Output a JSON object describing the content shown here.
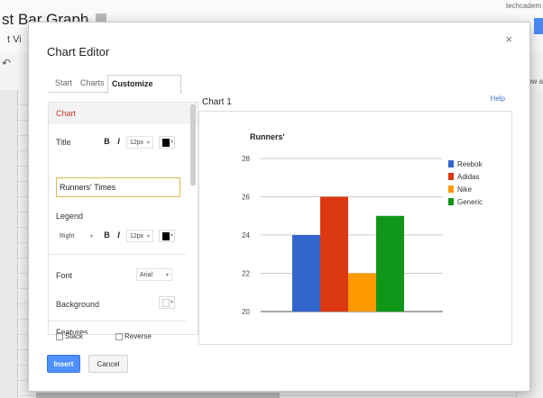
{
  "background": {
    "doc_title": "st Bar Graph",
    "menu_text": "t Vi",
    "user_label": "techcadem",
    "show_all_label": "Show a"
  },
  "dialog": {
    "title": "Chart Editor",
    "close_glyph": "×"
  },
  "tabs": [
    {
      "label": "Start",
      "active": false
    },
    {
      "label": "Charts",
      "active": false
    },
    {
      "label": "Customize",
      "active": true
    }
  ],
  "customize": {
    "section_title": "Chart",
    "title_label": "Title",
    "bold_label": "B",
    "italic_label": "I",
    "title_font_size": "12px",
    "title_color": "#000000",
    "title_value": "Runners' Times",
    "legend_label": "Legend",
    "legend_position": "Right",
    "legend_font_size": "12px",
    "legend_color": "#000000",
    "font_label": "Font",
    "font_value": "Arial",
    "background_label": "Background",
    "features_label": "Features",
    "stack_label": "Stack",
    "reverse_label": "Reverse"
  },
  "preview": {
    "label": "Chart 1",
    "help_label": "Help"
  },
  "buttons": {
    "insert_label": "Insert",
    "cancel_label": "Cancel"
  },
  "colors": {
    "accent": "#4d90fe",
    "section_red": "#c0392b"
  },
  "chart_data": {
    "type": "bar",
    "title": "Runners'",
    "categories": [
      ""
    ],
    "series": [
      {
        "name": "Reebok",
        "values": [
          24
        ],
        "color": "#3366cc"
      },
      {
        "name": "Adidas",
        "values": [
          26
        ],
        "color": "#dc3912"
      },
      {
        "name": "Nike",
        "values": [
          22
        ],
        "color": "#ff9900"
      },
      {
        "name": "Generic",
        "values": [
          25
        ],
        "color": "#109618"
      }
    ],
    "yticks": [
      "20",
      "22",
      "24",
      "26",
      "28"
    ],
    "ylim": [
      20,
      28
    ],
    "legend_position": "right",
    "grid": true
  }
}
